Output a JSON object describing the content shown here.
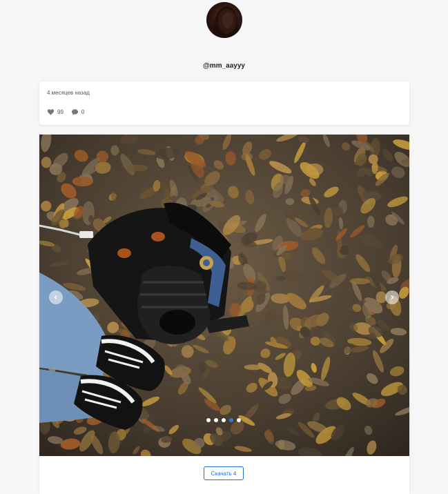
{
  "profile": {
    "username": "@mm_aayyy"
  },
  "post": {
    "time_ago": "4 месяцев назад",
    "likes": "99",
    "comments": "0"
  },
  "carousel": {
    "total_slides": 5,
    "active_slide": 4
  },
  "actions": {
    "download_label": "Скачать 4"
  },
  "icons": {
    "like": "heart-icon",
    "comment": "comment-bubble-icon",
    "prev": "chevron-left-icon",
    "next": "chevron-right-icon"
  },
  "colors": {
    "accent": "#1f6fcf",
    "active_dot": "#2f7bd6",
    "background": "#f6f6f6"
  }
}
